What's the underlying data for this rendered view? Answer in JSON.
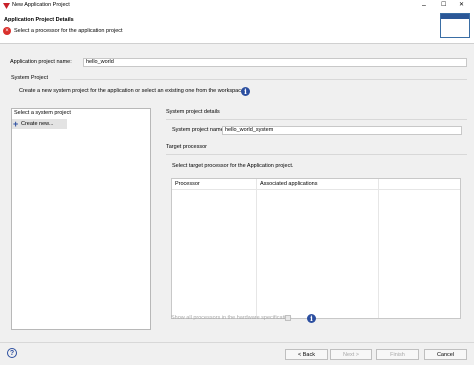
{
  "window": {
    "title": "New Application Project",
    "controls": {
      "minimize": "–",
      "maximize": "☐",
      "close": "✕"
    }
  },
  "header": {
    "title": "Application Project Details",
    "message": "Select a processor for the application project",
    "error_icon": "error-icon"
  },
  "app_project": {
    "label": "Application project name:",
    "value": "hello_world"
  },
  "system_project": {
    "group_label": "System Project",
    "description": "Create a new system project for the application or select an existing one from the workspace",
    "list_label": "Select a system project",
    "items": [
      {
        "label": "Create new..."
      }
    ],
    "details_label": "System project details",
    "name_label": "System project name:",
    "name_value": "hello_world_system"
  },
  "target_processor": {
    "label": "Target processor",
    "instruction": "Select target processor for the Application project.",
    "columns": [
      "Processor",
      "Associated applications"
    ],
    "show_all_label": "Show all processors in the hardware specification"
  },
  "buttons": {
    "help": "?",
    "back": "< Back",
    "next": "Next >",
    "finish": "Finish",
    "cancel": "Cancel"
  },
  "colors": {
    "accent": "#2c4fa0",
    "error": "#d9302c",
    "logo": "#c8202a"
  }
}
